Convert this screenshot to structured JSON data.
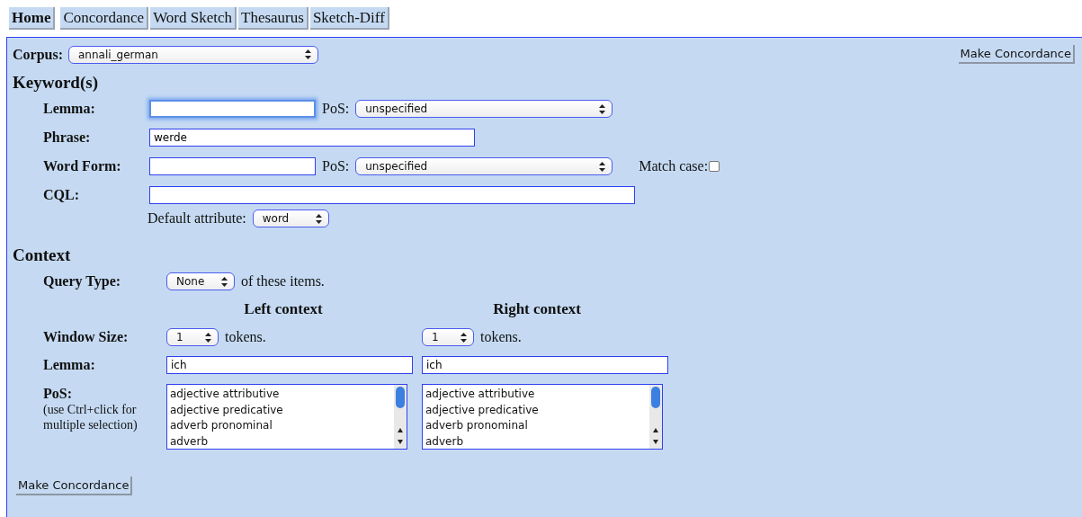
{
  "tabs": [
    {
      "label": "Home",
      "selected": true
    },
    {
      "label": "Concordance",
      "selected": false
    },
    {
      "label": "Word Sketch",
      "selected": false
    },
    {
      "label": "Thesaurus",
      "selected": false
    },
    {
      "label": "Sketch-Diff",
      "selected": false
    }
  ],
  "corpus": {
    "label": "Corpus:",
    "value": "annali_german"
  },
  "make_concordance_top": "Make Concordance",
  "keywords": {
    "heading": "Keyword(s)",
    "rows": [
      {
        "kind": "short",
        "label": "Lemma:",
        "focused": true,
        "pos": {
          "label": "PoS:",
          "value": "unspecified"
        }
      },
      {
        "kind": "medium",
        "label": "Phrase:",
        "value": "werde",
        "focused": false
      },
      {
        "kind": "short",
        "label": "Word Form:",
        "focused": false,
        "pos": {
          "label": "PoS:",
          "value": "unspecified"
        },
        "match_case": {
          "label": "Match case:",
          "checked": false
        }
      },
      {
        "kind": "wide",
        "label": "CQL:",
        "focused": false,
        "default_attribute": {
          "label": "Default attribute:",
          "value": "word"
        }
      }
    ]
  },
  "context": {
    "heading": "Context",
    "query_type": {
      "label": "Query Type:",
      "value": "None",
      "suffix": "of these items."
    },
    "columns": [
      "Left context",
      "Right context"
    ],
    "window_size": {
      "label": "Window Size:",
      "values": [
        {
          "value": "1",
          "suffix": "tokens."
        },
        {
          "value": "1",
          "suffix": "tokens."
        }
      ]
    },
    "lemma": {
      "label": "Lemma:",
      "values": [
        "ich",
        "ich"
      ]
    },
    "pos": {
      "label": "PoS:",
      "note": "(use Ctrl+click for multiple selection)",
      "lists": [
        [
          "adjective attributive",
          "adjective predicative",
          "adverb pronominal",
          "adverb"
        ],
        [
          "adjective attributive",
          "adjective predicative",
          "adverb pronominal",
          "adverb"
        ]
      ]
    }
  },
  "make_concordance_bottom": "Make Concordance"
}
